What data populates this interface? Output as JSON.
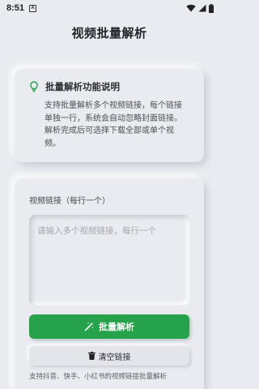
{
  "status_bar": {
    "time": "8:51",
    "notification_glyph": "A",
    "icons": [
      "wifi-icon",
      "signal-icon",
      "battery-icon"
    ]
  },
  "header": {
    "title": "视频批量解析"
  },
  "info_card": {
    "icon": "lightbulb-icon",
    "icon_color": "#25a24a",
    "title": "批量解析功能说明",
    "text": "支持批量解析多个视频链接，每个链接单独一行，系统会自动忽略封面链接。解析完成后可选择下载全部或单个视频。"
  },
  "form": {
    "label": "视频链接（每行一个）",
    "input_value": "",
    "placeholder": "请输入多个视频链接，每行一个",
    "parse_button_label": "批量解析",
    "parse_button_icon": "magic-wand-icon",
    "parse_button_color": "#25a24a",
    "clear_button_label": "清空链接",
    "clear_button_icon": "trash-icon",
    "hint": "支持抖音、快手、小红书的视频链接批量解析"
  }
}
